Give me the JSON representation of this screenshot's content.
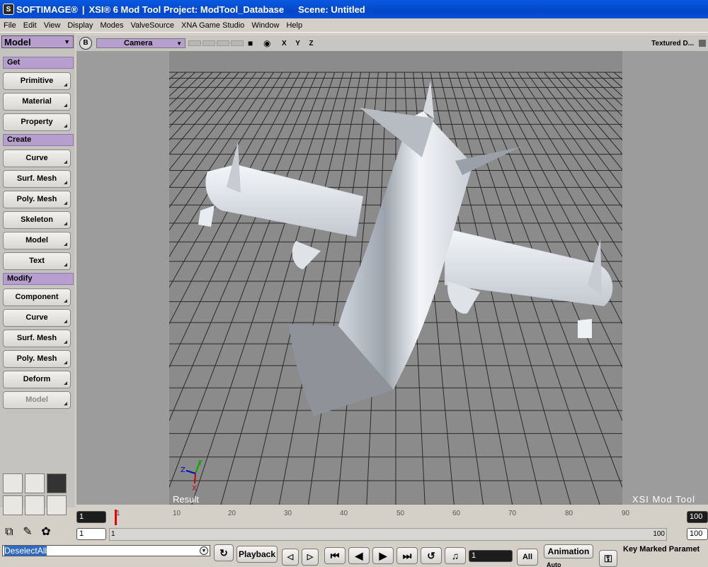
{
  "window": {
    "title_parts": [
      "SOFTIMAGE®",
      "|",
      "XSI® 6 Mod Tool Project: ModTool_Database",
      "Scene: Untitled"
    ],
    "icon": "softimage-logo-icon"
  },
  "menu": [
    "File",
    "Edit",
    "View",
    "Display",
    "Modes",
    "ValveSource",
    "XNA Game Studio",
    "Window",
    "Help"
  ],
  "toolbar": {
    "mode": "Model",
    "sections": {
      "get": {
        "label": "Get",
        "buttons": [
          "Primitive",
          "Material",
          "Property"
        ]
      },
      "create": {
        "label": "Create",
        "buttons": [
          "Curve",
          "Surf. Mesh",
          "Poly. Mesh",
          "Skeleton",
          "Model",
          "Text"
        ]
      },
      "modify": {
        "label": "Modify",
        "buttons": [
          "Component",
          "Curve",
          "Surf. Mesh",
          "Poly. Mesh",
          "Deform",
          "Model"
        ]
      }
    }
  },
  "viewport": {
    "button_b": "B",
    "camera": "Camera",
    "axes": "X Y Z",
    "display_mode": "Textured D...",
    "result_label": "Result",
    "brand": "XSI Mod Tool",
    "axis_gizmo": {
      "x": "X",
      "y": "Y",
      "z": "Z"
    },
    "colors": {
      "background": "#9c9c9c",
      "grid": "#2a2a2a",
      "frame": "#8b8b8b",
      "model": "#e9edf1"
    }
  },
  "timeline": {
    "current_frame": "1",
    "start_frame": "1",
    "end_frame": "100",
    "ticks": [
      "1",
      "10",
      "20",
      "30",
      "40",
      "50",
      "60",
      "70",
      "80",
      "90"
    ],
    "range_start": "1",
    "range_start_label": "1",
    "range_end_label": "100",
    "range_end": "100"
  },
  "playback": {
    "command": "DeselectAll",
    "label": "Playback",
    "frame_value": "1",
    "all": "All",
    "animation": "Animation",
    "auto": "Auto",
    "key_marked": "Key Marked Paramet"
  }
}
